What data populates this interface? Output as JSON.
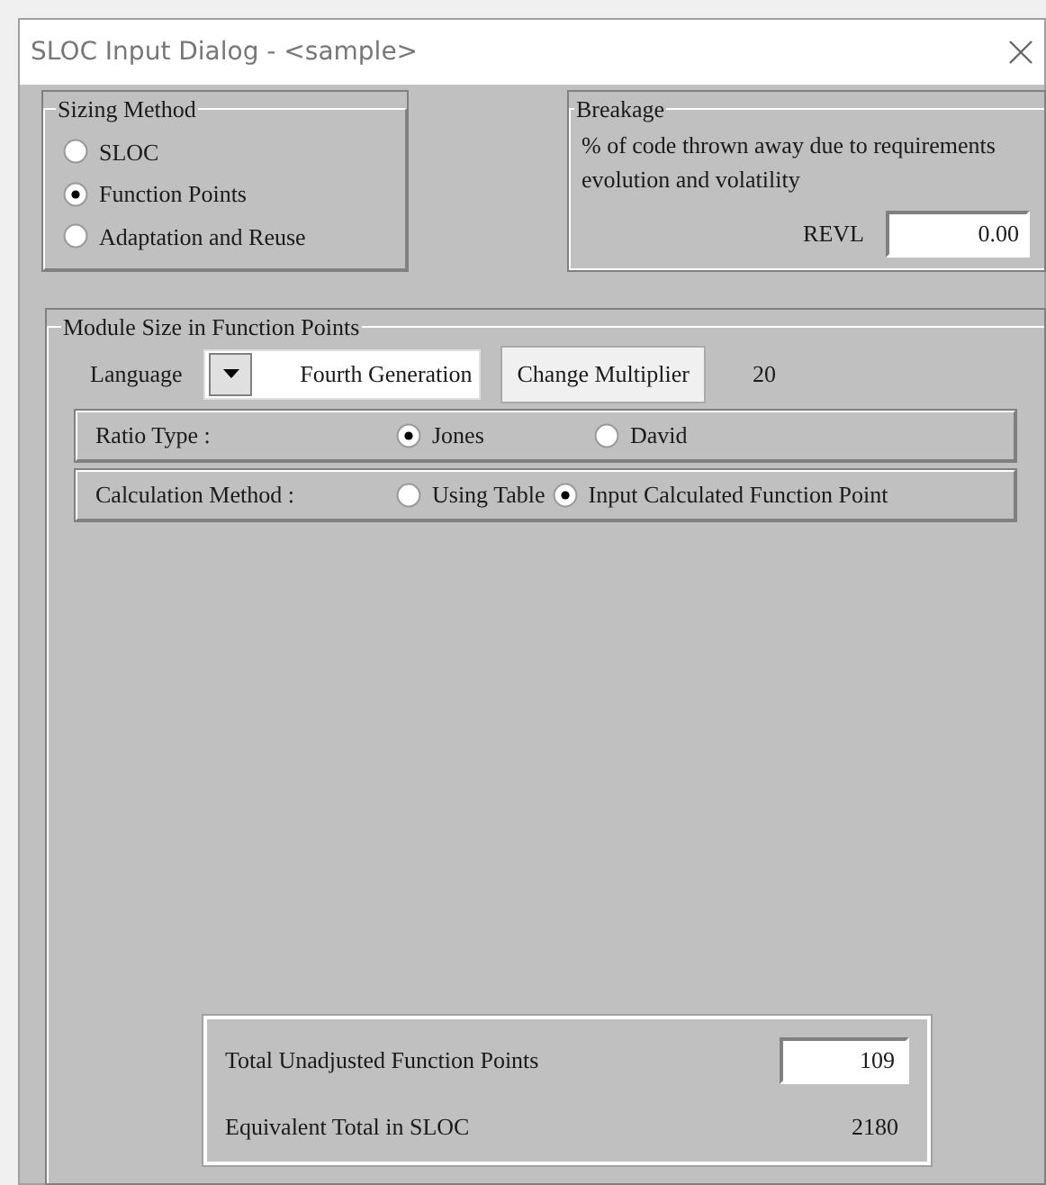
{
  "window": {
    "title": "SLOC Input Dialog - <sample>"
  },
  "sizing_method": {
    "title": "Sizing Method",
    "options": [
      {
        "label": "SLOC",
        "selected": false
      },
      {
        "label": "Function Points",
        "selected": true
      },
      {
        "label": "Adaptation and Reuse",
        "selected": false
      }
    ]
  },
  "breakage": {
    "title": "Breakage",
    "description": "% of code thrown away due to requirements evolution and volatility",
    "field_label": "REVL",
    "value": "0.00"
  },
  "module_size": {
    "title": "Module Size in Function Points",
    "language_label": "Language",
    "language": "Fourth Generation",
    "change_button": "Change Multiplier",
    "multiplier": "20",
    "ratio_type": {
      "label": "Ratio Type :",
      "options": [
        {
          "label": "Jones",
          "selected": true
        },
        {
          "label": "David",
          "selected": false
        }
      ]
    },
    "calculation_method": {
      "label": "Calculation Method :",
      "options": [
        {
          "label": "Using Table",
          "selected": false
        },
        {
          "label": "Input Calculated Function Point",
          "selected": true
        }
      ]
    },
    "totals": {
      "unadjusted_label": "Total Unadjusted Function Points",
      "unadjusted_value": "109",
      "equivalent_label": "Equivalent Total in SLOC",
      "equivalent_value": "2180"
    }
  }
}
